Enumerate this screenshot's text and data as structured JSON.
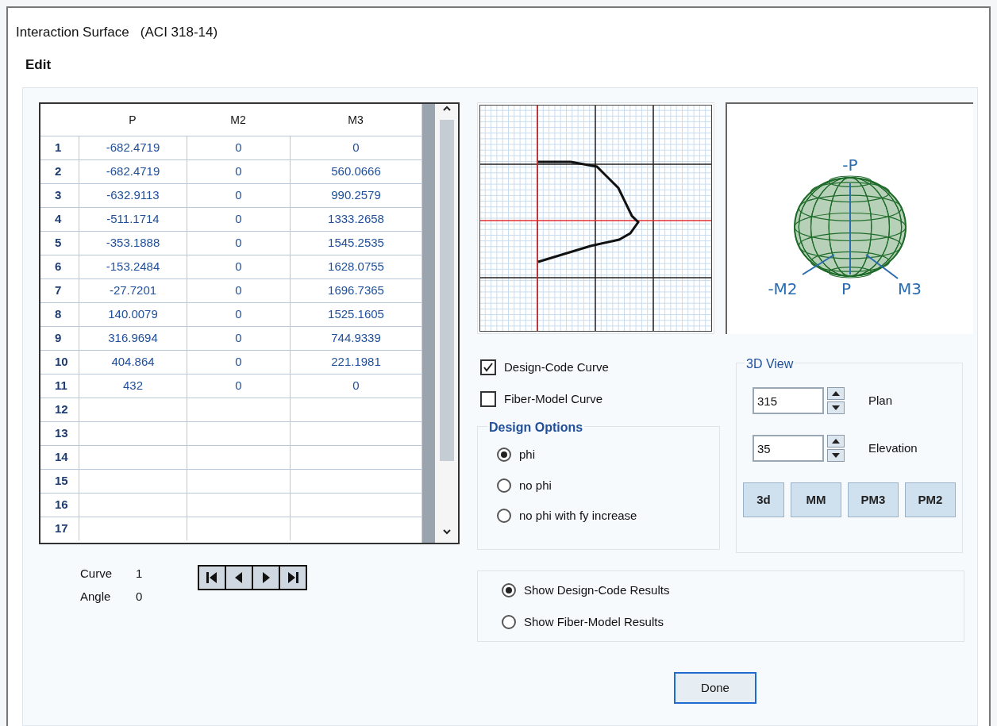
{
  "window": {
    "title": "Interaction Surface   (ACI 318-14)"
  },
  "menu": [
    "Edit"
  ],
  "table": {
    "columns": [
      "P",
      "M2",
      "M3"
    ],
    "rows": [
      {
        "n": "1",
        "cells": [
          "-682.4719",
          "0",
          "0"
        ]
      },
      {
        "n": "2",
        "cells": [
          "-682.4719",
          "0",
          "560.0666"
        ]
      },
      {
        "n": "3",
        "cells": [
          "-632.9113",
          "0",
          "990.2579"
        ]
      },
      {
        "n": "4",
        "cells": [
          "-511.1714",
          "0",
          "1333.2658"
        ]
      },
      {
        "n": "5",
        "cells": [
          "-353.1888",
          "0",
          "1545.2535"
        ]
      },
      {
        "n": "6",
        "cells": [
          "-153.2484",
          "0",
          "1628.0755"
        ]
      },
      {
        "n": "7",
        "cells": [
          "-27.7201",
          "0",
          "1696.7365"
        ]
      },
      {
        "n": "8",
        "cells": [
          "140.0079",
          "0",
          "1525.1605"
        ]
      },
      {
        "n": "9",
        "cells": [
          "316.9694",
          "0",
          "744.9339"
        ]
      },
      {
        "n": "10",
        "cells": [
          "404.864",
          "0",
          "221.1981"
        ]
      },
      {
        "n": "11",
        "cells": [
          "432",
          "0",
          "0"
        ]
      },
      {
        "n": "12"
      },
      {
        "n": "13"
      },
      {
        "n": "14"
      },
      {
        "n": "15"
      },
      {
        "n": "16"
      },
      {
        "n": "17"
      }
    ]
  },
  "nav": {
    "curve_label": "Curve",
    "curve": "1",
    "angle_label": "Angle",
    "angle": "0"
  },
  "view3d_labels": [
    "-P",
    "-M2",
    "P",
    "M3"
  ],
  "curves": [
    {
      "label": "Design-Code Curve",
      "checked": true
    },
    {
      "label": "Fiber-Model Curve",
      "checked": false
    }
  ],
  "design_options": {
    "title": "Design Options",
    "options": [
      {
        "label": "phi",
        "selected": true
      },
      {
        "label": "no phi",
        "selected": false
      },
      {
        "label": "no phi with fy increase",
        "selected": false
      }
    ]
  },
  "view3d": {
    "title": "3D View",
    "fields": [
      {
        "value": "315",
        "label": "Plan"
      },
      {
        "value": "35",
        "label": "Elevation"
      }
    ],
    "buttons": [
      "3d",
      "MM",
      "PM3",
      "PM2"
    ]
  },
  "results": [
    {
      "label": "Show Design-Code Results",
      "selected": true
    },
    {
      "label": "Show Fiber-Model Results",
      "selected": false
    }
  ],
  "done": "Done"
}
